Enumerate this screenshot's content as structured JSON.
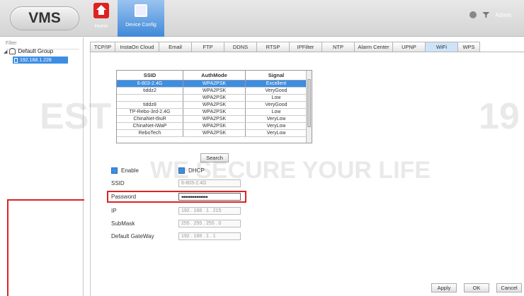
{
  "header": {
    "logo": "VMS",
    "nav": [
      {
        "label": "Home",
        "icon": "home-icon"
      },
      {
        "label": "Device Config",
        "icon": "device-config-icon"
      }
    ],
    "admin_label": "Admin"
  },
  "sidebar": {
    "filter_label": "Filter",
    "tree": {
      "root": "Default Group",
      "child": "192.168.1.228"
    }
  },
  "tabs": [
    "TCP/IP",
    "InstaOn Cloud",
    "Email",
    "FTP",
    "DDNS",
    "RTSP",
    "IPFilter",
    "NTP",
    "Alarm Center",
    "UPNP",
    "WiFi",
    "WPS"
  ],
  "active_tab": "WiFi",
  "ssid_table": {
    "columns": [
      "SSID",
      "AuthMode",
      "Signal"
    ],
    "rows": [
      [
        "6-803-2.4G",
        "WPA2PSK",
        "Excellent"
      ],
      [
        "tiddz2",
        "WPA2PSK",
        "VeryGood"
      ],
      [
        "",
        "WPA2PSK",
        "Low"
      ],
      [
        "tiddz8",
        "WPA2PSK",
        "VeryGood"
      ],
      [
        "TP-Rebo-3rd-2.4G",
        "WPA2PSK",
        "Low"
      ],
      [
        "ChinaNet-t9uR",
        "WPA2PSK",
        "VeryLow"
      ],
      [
        "ChinaNet-iWaP",
        "WPA2PSK",
        "VeryLow"
      ],
      [
        "ReboTech",
        "WPA2PSK",
        "VeryLow"
      ]
    ],
    "selected_index": 0
  },
  "search_label": "Search",
  "form": {
    "enable_label": "Enable",
    "dhcp_label": "DHCP",
    "ssid_label": "SSID",
    "ssid_value": "6-803-2.4G",
    "password_label": "Password",
    "password_value": "••••••••••••••",
    "ip_label": "IP",
    "ip_value": "192 . 168 . 1 . 215",
    "submask_label": "SubMask",
    "submask_value": "255 . 255 . 255 . 0",
    "gateway_label": "Default GateWay",
    "gateway_value": "192 . 168 . 1 . 1"
  },
  "buttons": {
    "apply": "Apply",
    "ok": "OK",
    "cancel": "Cancel"
  },
  "watermark": {
    "brand_left": "EST",
    "slogan": "WE SECURE YOUR LIFE",
    "brand_right": "19"
  },
  "colors": {
    "accent": "#3c8ee3",
    "highlight": "#dd2222"
  }
}
